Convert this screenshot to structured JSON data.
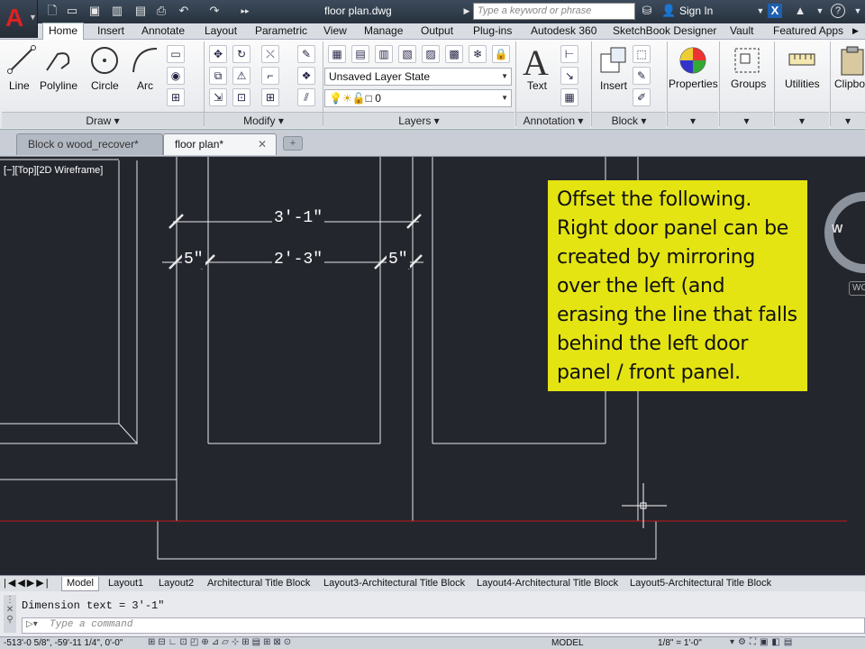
{
  "title_bar": {
    "logo_letter": "A",
    "document_title": "floor plan.dwg",
    "search_placeholder": "Type a keyword or phrase",
    "sign_in": "Sign In",
    "help": "?"
  },
  "ribbon_tabs": [
    "Home",
    "Insert",
    "Annotate",
    "Layout",
    "Parametric",
    "View",
    "Manage",
    "Output",
    "Plug-ins",
    "Autodesk 360",
    "SketchBook Designer",
    "Vault",
    "Featured Apps"
  ],
  "ribbon": {
    "draw": {
      "line": "Line",
      "polyline": "Polyline",
      "circle": "Circle",
      "arc": "Arc",
      "panel": "Draw"
    },
    "modify": {
      "panel": "Modify"
    },
    "layers": {
      "state": "Unsaved Layer State",
      "current": "0",
      "panel": "Layers"
    },
    "annotation": {
      "text": "Text",
      "panel": "Annotation"
    },
    "block": {
      "insert": "Insert",
      "panel": "Block"
    },
    "properties": "Properties",
    "groups": "Groups",
    "utilities": "Utilities",
    "clipboard": "Clipbo"
  },
  "file_tabs": [
    {
      "label": "Block o wood_recover*"
    },
    {
      "label": "floor plan*"
    }
  ],
  "viewport": {
    "label": "[−][Top][2D Wireframe]",
    "dim_top": "3'-1\"",
    "dim_left": "5\"",
    "dim_mid": "2'-3\"",
    "dim_right": "5\"",
    "viewcube_w": "W",
    "wcs": "WC",
    "note": "Offset the following. Right door panel can be created by mirroring over the left (and erasing the line that falls behind the left door panel / front panel."
  },
  "layout_tabs": [
    "Model",
    "Layout1",
    "Layout2",
    "Architectural Title Block",
    "Layout3-Architectural Title Block",
    "Layout4-Architectural Title Block",
    "Layout5-Architectural Title Block"
  ],
  "command": {
    "history": "Dimension text = 3'-1\"",
    "placeholder": "Type a command"
  },
  "status_bar": {
    "coords": "-513'-0 5/8\", -59'-11 1/4\", 0'-0\"",
    "model": "MODEL",
    "scale": "1/8\" = 1'-0\""
  }
}
